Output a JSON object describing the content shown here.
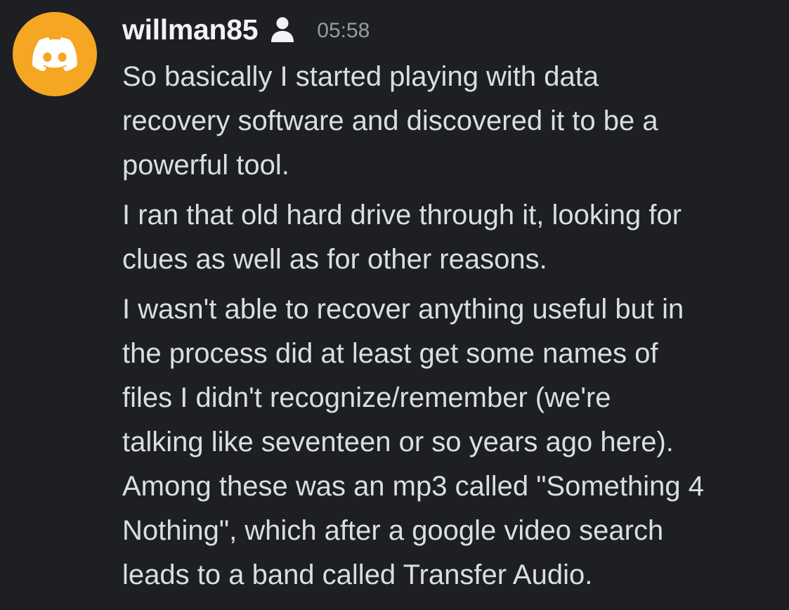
{
  "message": {
    "author": "willman85",
    "timestamp": "05:58",
    "avatar_color": "#f5a623",
    "icons": {
      "avatar": "discord-logo-icon",
      "author_badge": "person-icon"
    },
    "paragraphs": [
      {
        "lines": [
          "So basically I started playing with data",
          "recovery software and discovered it to be a",
          "powerful tool."
        ]
      },
      {
        "lines": [
          "I ran that old hard drive through it, looking for",
          "clues as well as for other reasons."
        ]
      },
      {
        "lines": [
          "I wasn't able to recover anything useful but in",
          "the process did at least get some names of",
          "files I didn't recognize/remember (we're",
          "talking like seventeen or so years ago here).",
          "Among these was an mp3 called \"Something 4",
          "Nothing\", which after a google video search",
          "leads to a band called Transfer Audio."
        ]
      }
    ]
  }
}
